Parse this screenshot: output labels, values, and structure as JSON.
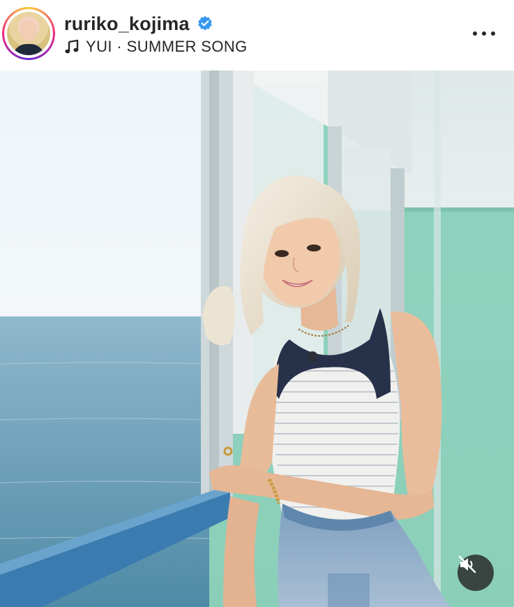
{
  "post": {
    "username": "ruriko_kojima",
    "verified": true,
    "audio": "YUI · SUMMER SONG"
  },
  "icons": {
    "verified": "verified-badge-icon",
    "music": "music-note-icon",
    "more": "more-options-icon",
    "mute": "speaker-muted-icon"
  },
  "colors": {
    "text": "#262626",
    "verified": "#3897f0",
    "ring_start": "#f9ce34",
    "ring_mid": "#ee2a7b"
  }
}
